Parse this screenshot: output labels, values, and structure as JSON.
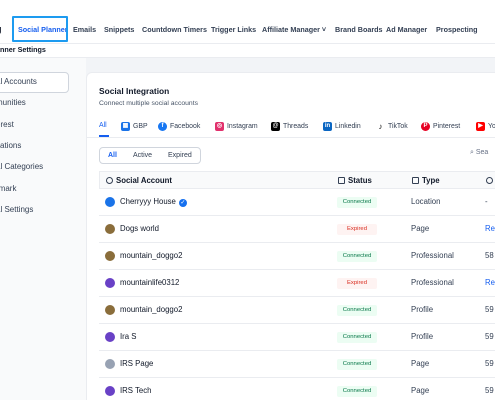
{
  "topnav": {
    "prefix": "g",
    "tabs": [
      "Social Planner",
      "Emails",
      "Snippets",
      "Countdown Timers",
      "Trigger Links",
      "Affiliate Manager",
      "Brand Boards",
      "Ad Manager",
      "Prospecting"
    ],
    "affiliate_chevron": "˅"
  },
  "subtitle": "anner Settings",
  "sidebar": {
    "items": [
      "al Accounts",
      "munities",
      "erest",
      "cations",
      "al Categories",
      "rmark",
      "al Settings"
    ]
  },
  "card": {
    "title": "Social Integration",
    "description": "Connect multiple social accounts",
    "platform_tabs": [
      "All",
      "GBP",
      "Facebook",
      "Instagram",
      "Threads",
      "Linkedin",
      "TikTok",
      "Pinterest",
      "Yo"
    ],
    "filters": [
      "All",
      "Active",
      "Expired"
    ],
    "search_placeholder": "Sea",
    "columns": [
      "Social Account",
      "Status",
      "Type"
    ]
  },
  "rows": [
    {
      "name": "Cherryyy House",
      "verified": true,
      "status": "Connected",
      "type": "Location",
      "extra": "-",
      "icon": "gbp-icon"
    },
    {
      "name": "Dogs world",
      "verified": false,
      "status": "Expired",
      "type": "Page",
      "extra": "Re",
      "icon": "dog-avatar-icon"
    },
    {
      "name": "mountain_doggo2",
      "verified": false,
      "status": "Connected",
      "type": "Professional",
      "extra": "58",
      "icon": "dog-avatar-icon"
    },
    {
      "name": "mountainlife0312",
      "verified": false,
      "status": "Expired",
      "type": "Professional",
      "extra": "Re",
      "icon": "avatar-icon"
    },
    {
      "name": "mountain_doggo2",
      "verified": false,
      "status": "Connected",
      "type": "Profile",
      "extra": "59",
      "icon": "dog-avatar-icon"
    },
    {
      "name": "Ira S",
      "verified": false,
      "status": "Connected",
      "type": "Profile",
      "extra": "59",
      "icon": "avatar-icon"
    },
    {
      "name": "IRS Page",
      "verified": false,
      "status": "Connected",
      "type": "Page",
      "extra": "59",
      "icon": "page-avatar-icon"
    },
    {
      "name": "IRS Tech",
      "verified": false,
      "status": "Connected",
      "type": "Page",
      "extra": "59",
      "icon": "avatar-icon"
    }
  ],
  "colors": {
    "accent": "#155eef",
    "connected_bg": "#ecfdf3",
    "connected_text": "#067647",
    "expired_bg": "#fef3f2",
    "expired_text": "#d92d20",
    "highlight": "#1d9bf0"
  }
}
